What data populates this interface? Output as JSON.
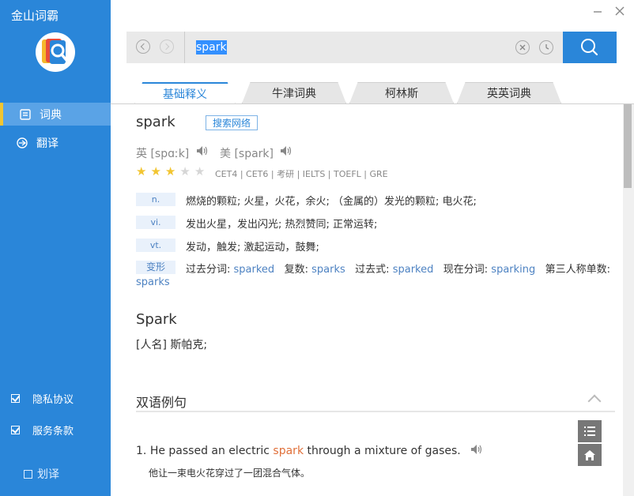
{
  "app": {
    "title": "金山词霸"
  },
  "sidebar": {
    "items": [
      {
        "label": "词典",
        "icon": "dictionary-icon",
        "active": true
      },
      {
        "label": "翻译",
        "icon": "translate-icon",
        "active": false
      }
    ],
    "checks": [
      {
        "label": "隐私协议",
        "checked": true
      },
      {
        "label": "服务条款",
        "checked": true
      }
    ],
    "huayi_label": "划译"
  },
  "search": {
    "value": "spark"
  },
  "tabs": [
    {
      "label": "基础释义",
      "active": true
    },
    {
      "label": "牛津词典",
      "active": false
    },
    {
      "label": "柯林斯",
      "active": false
    },
    {
      "label": "英英词典",
      "active": false
    }
  ],
  "entry": {
    "word": "spark",
    "web_search_label": "搜索网络",
    "uk_phonetic": "英 [spɑːk]",
    "us_phonetic": "美 [spark]",
    "stars_filled": 3,
    "stars_total": 5,
    "exams": "CET4 | CET6 | 考研 | IELTS | TOEFL | GRE",
    "definitions": [
      {
        "pos": "n.",
        "text": "燃烧的颗粒; 火星，火花，余火; （金属的）发光的颗粒; 电火花;"
      },
      {
        "pos": "vi.",
        "text": "发出火星，发出闪光; 热烈赞同; 正常运转;"
      },
      {
        "pos": "vt.",
        "text": "发动，触发; 激起运动，鼓舞;"
      }
    ],
    "forms_label": "变形",
    "forms": [
      {
        "label": "过去分词:",
        "value": "sparked"
      },
      {
        "label": "复数:",
        "value": "sparks"
      },
      {
        "label": "过去式:",
        "value": "sparked"
      },
      {
        "label": "现在分词:",
        "value": "sparking"
      },
      {
        "label": "第三人称单数:",
        "value": "sparks"
      }
    ],
    "name_word": "Spark",
    "name_def": "[人名] 斯帕克;"
  },
  "examples": {
    "section_title": "双语例句",
    "items": [
      {
        "num": "1.",
        "before": "He passed an electric",
        "highlight": "spark",
        "after": "through a mixture of gases.",
        "cn": "他让一束电火花穿过了一团混合气体。"
      }
    ]
  },
  "colors": {
    "accent": "#2a86d9",
    "sidebar": "#2a86d9",
    "highlight": "#e0703a",
    "star": "#f2c531"
  }
}
